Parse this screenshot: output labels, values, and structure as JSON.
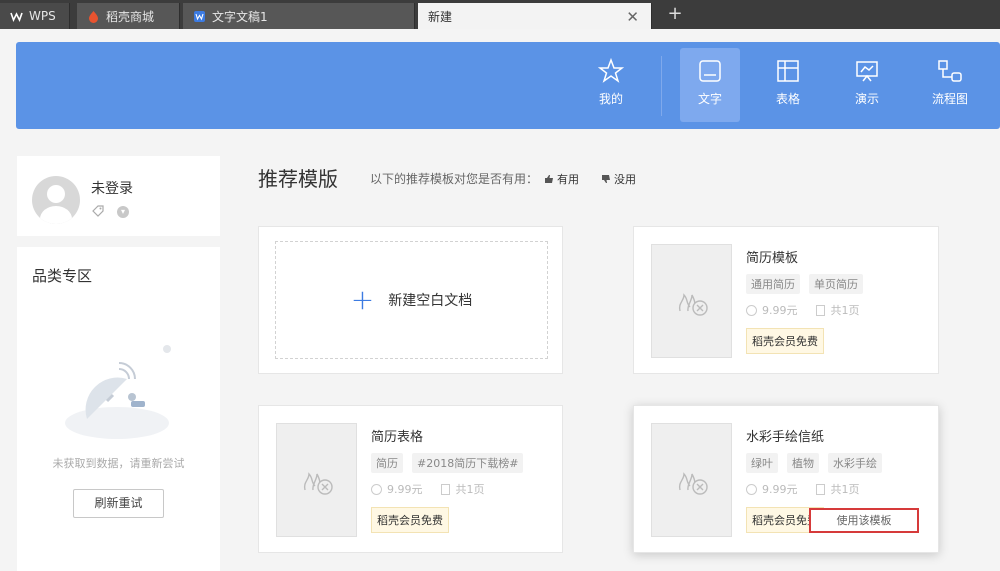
{
  "tabs": [
    {
      "label": "WPS",
      "icon": "wps-logo-icon"
    },
    {
      "label": "稻壳商城",
      "icon": "docer-icon"
    },
    {
      "label": "文字文稿1",
      "icon": "writer-icon"
    },
    {
      "label": "新建",
      "icon": ""
    }
  ],
  "new_tab_label": "+",
  "close_label": "✕",
  "nav": [
    {
      "label": "我的",
      "icon": "star-icon"
    },
    {
      "label": "文字",
      "icon": "document-icon"
    },
    {
      "label": "表格",
      "icon": "spreadsheet-icon"
    },
    {
      "label": "演示",
      "icon": "presentation-icon"
    },
    {
      "label": "流程图",
      "icon": "flowchart-icon"
    }
  ],
  "user": {
    "name": "未登录"
  },
  "category": {
    "title": "品类专区",
    "empty_text": "未获取到数据，请重新尝试",
    "refresh_label": "刷新重试"
  },
  "main": {
    "title": "推荐模版",
    "feedback_prompt": "以下的推荐模板对您是否有用：",
    "useful_label": "有用",
    "useless_label": "没用",
    "blank_label": "新建空白文档",
    "templates": [
      {
        "title": "简历模板",
        "tags": [
          "通用简历",
          "单页简历"
        ],
        "price": "9.99元",
        "pages": "共1页",
        "vip": "稻壳会员免费"
      },
      {
        "title": "简历表格",
        "tags": [
          "简历",
          "#2018简历下载榜#"
        ],
        "price": "9.99元",
        "pages": "共1页",
        "vip": "稻壳会员免费"
      },
      {
        "title": "水彩手绘信纸",
        "tags": [
          "绿叶",
          "植物",
          "水彩手绘"
        ],
        "price": "9.99元",
        "pages": "共1页",
        "vip": "稻壳会员免费",
        "use_label": "使用该模板"
      }
    ]
  },
  "colors": {
    "header_blue": "#5b93e6",
    "accent": "#3c7be2",
    "highlight_red": "#d63a3a"
  }
}
